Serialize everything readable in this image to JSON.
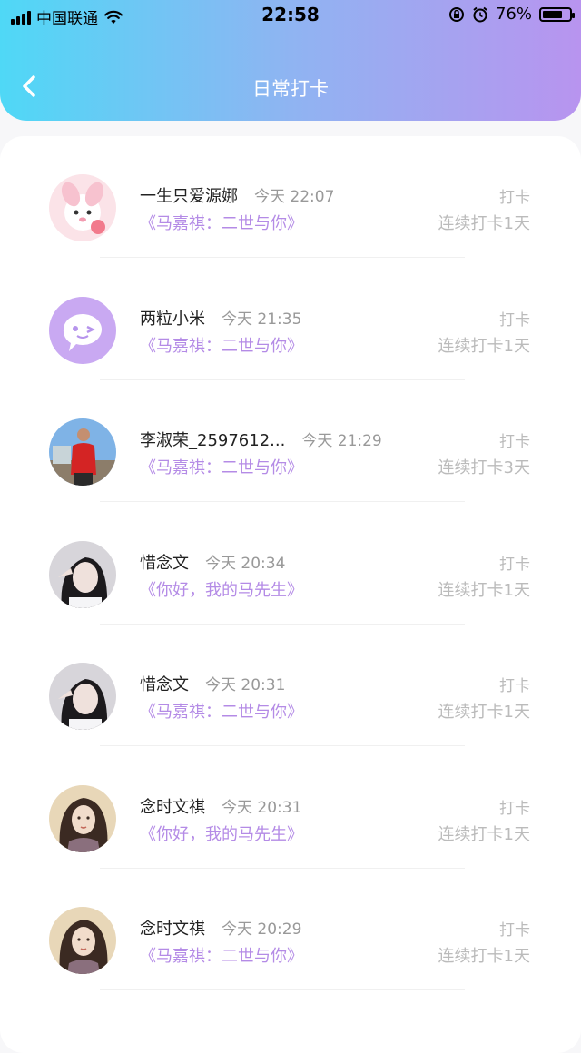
{
  "status_bar": {
    "carrier": "中国联通",
    "time": "22:58",
    "battery_percent": "76%",
    "battery_level": 0.76
  },
  "nav": {
    "title": "日常打卡"
  },
  "items": [
    {
      "name": "一生只爱源娜",
      "time": "今天 22:07",
      "book": "《马嘉祺：二世与你》",
      "checkin": "打卡",
      "streak": "连续打卡1天",
      "avatar_icon": "sheep-avatar-icon"
    },
    {
      "name": "两粒小米",
      "time": "今天 21:35",
      "book": "《马嘉祺：二世与你》",
      "checkin": "打卡",
      "streak": "连续打卡1天",
      "avatar_icon": "chat-bubble-avatar-icon"
    },
    {
      "name": "李淑荣_2597612...",
      "time": "今天 21:29",
      "book": "《马嘉祺：二世与你》",
      "checkin": "打卡",
      "streak": "连续打卡3天",
      "avatar_icon": "person-photo-avatar-icon"
    },
    {
      "name": "惜念文",
      "time": "今天 20:34",
      "book": "《你好，我的马先生》",
      "checkin": "打卡",
      "streak": "连续打卡1天",
      "avatar_icon": "girl-photo-avatar-icon"
    },
    {
      "name": "惜念文",
      "time": "今天 20:31",
      "book": "《马嘉祺：二世与你》",
      "checkin": "打卡",
      "streak": "连续打卡1天",
      "avatar_icon": "girl-photo-avatar-icon"
    },
    {
      "name": "念时文祺",
      "time": "今天 20:31",
      "book": "《你好，我的马先生》",
      "checkin": "打卡",
      "streak": "连续打卡1天",
      "avatar_icon": "illustration-avatar-icon"
    },
    {
      "name": "念时文祺",
      "time": "今天 20:29",
      "book": "《马嘉祺：二世与你》",
      "checkin": "打卡",
      "streak": "连续打卡1天",
      "avatar_icon": "illustration-avatar-icon"
    }
  ],
  "colors": {
    "gradient_start": "#4fd8f6",
    "gradient_end": "#b894ef",
    "book_text": "#b48be6"
  }
}
